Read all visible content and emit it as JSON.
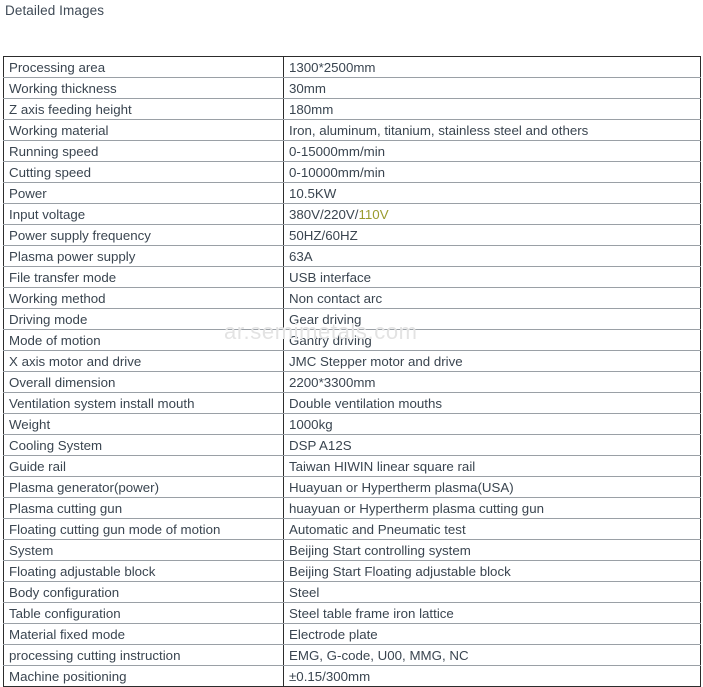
{
  "page": {
    "heading": "Detailed Images",
    "watermark": "ar.semimetals.com",
    "accent_color": "#9a9b2e",
    "text_color": "#3a4550",
    "border_color": "#9aa0a6",
    "frame_color": "#2c2c2c"
  },
  "spec_table": {
    "rows": [
      {
        "label": "Processing area",
        "value": "1300*2500mm"
      },
      {
        "label": "Working thickness",
        "value": "30mm"
      },
      {
        "label": "Z axis feeding height",
        "value": "180mm"
      },
      {
        "label": "Working material",
        "value": "Iron, aluminum, titanium, stainless steel and others"
      },
      {
        "label": "Running speed",
        "value": "0-15000mm/min"
      },
      {
        "label": "Cutting speed",
        "value": "0-10000mm/min"
      },
      {
        "label": "Power",
        "value": "10.5KW"
      },
      {
        "label": "Input voltage",
        "value": "380V/220V/",
        "value_accent": "110V"
      },
      {
        "label": "Power supply frequency",
        "value": "50HZ/60HZ"
      },
      {
        "label": "Plasma power supply",
        "value": "63A"
      },
      {
        "label": "File transfer mode",
        "value": "USB interface"
      },
      {
        "label": "Working method",
        "value": "Non contact arc"
      },
      {
        "label": "Driving mode",
        "value": "Gear driving"
      },
      {
        "label": "Mode of motion",
        "value": "Gantry driving"
      },
      {
        "label": "X axis motor and drive",
        "value": "JMC Stepper motor and drive"
      },
      {
        "label": "Overall dimension",
        "value": "2200*3300mm"
      },
      {
        "label": "Ventilation system install mouth",
        "value": "Double ventilation mouths"
      },
      {
        "label": "Weight",
        "value": "1000kg"
      },
      {
        "label": "Cooling System",
        "value": " DSP A12S"
      },
      {
        "label": "Guide rail",
        "value": "Taiwan HIWIN linear square rail"
      },
      {
        "label": "Plasma generator(power)",
        "value": "Huayuan or Hypertherm plasma(USA)"
      },
      {
        "label": "Plasma cutting gun",
        "value": "huayuan or Hypertherm plasma cutting gun"
      },
      {
        "label": "Floating cutting gun mode of motion",
        "value": "Automatic and Pneumatic test"
      },
      {
        "label": "System",
        "value": "Beijing Start controlling system"
      },
      {
        "label": "Floating adjustable block",
        "value": "Beijing Start Floating adjustable block"
      },
      {
        "label": "Body configuration",
        "value": "Steel"
      },
      {
        "label": "Table configuration",
        "value": "Steel table frame iron lattice"
      },
      {
        "label": "Material fixed mode",
        "value": "Electrode plate"
      },
      {
        "label": "processing cutting instruction",
        "value": "EMG, G-code, U00, MMG, NC"
      },
      {
        "label": "Machine positioning",
        "value": "±0.15/300mm"
      }
    ]
  }
}
